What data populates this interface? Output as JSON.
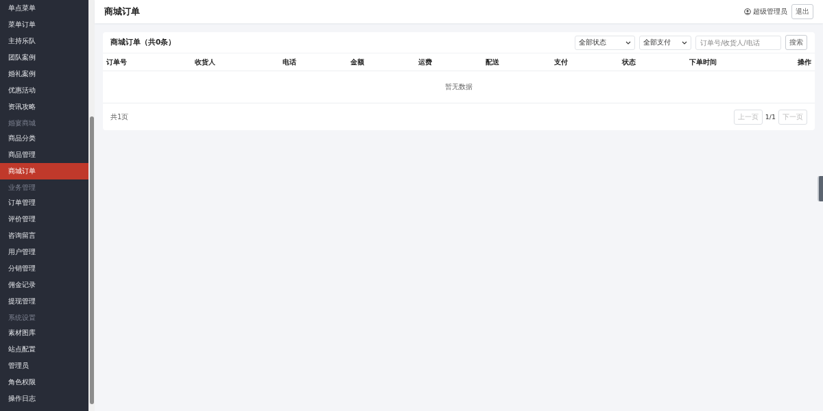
{
  "sidebar": {
    "sections": [
      {
        "items": [
          {
            "label": "单点菜单",
            "selected": false
          },
          {
            "label": "菜单订单",
            "selected": false
          },
          {
            "label": "主持乐队",
            "selected": false
          },
          {
            "label": "团队案例",
            "selected": false
          },
          {
            "label": "婚礼案例",
            "selected": false
          },
          {
            "label": "优惠活动",
            "selected": false
          },
          {
            "label": "资讯攻略",
            "selected": false
          }
        ]
      },
      {
        "label": "婚宴商城",
        "items": [
          {
            "label": "商品分类",
            "selected": false
          },
          {
            "label": "商品管理",
            "selected": false
          },
          {
            "label": "商城订单",
            "selected": true
          }
        ]
      },
      {
        "label": "业务管理",
        "items": [
          {
            "label": "订单管理",
            "selected": false
          },
          {
            "label": "评价管理",
            "selected": false
          },
          {
            "label": "咨询留言",
            "selected": false
          },
          {
            "label": "用户管理",
            "selected": false
          },
          {
            "label": "分销管理",
            "selected": false
          },
          {
            "label": "佣金记录",
            "selected": false
          },
          {
            "label": "提现管理",
            "selected": false
          }
        ]
      },
      {
        "label": "系统设置",
        "items": [
          {
            "label": "素材图库",
            "selected": false
          },
          {
            "label": "站点配置",
            "selected": false
          },
          {
            "label": "管理员",
            "selected": false
          },
          {
            "label": "角色权限",
            "selected": false
          },
          {
            "label": "操作日志",
            "selected": false
          }
        ]
      }
    ]
  },
  "header": {
    "title": "商城订单",
    "user": "超级管理员",
    "logout": "退出"
  },
  "panel": {
    "title": "商城订单（共0条）",
    "filters": [
      {
        "value": "全部状态"
      },
      {
        "value": "全部支付"
      }
    ],
    "search": {
      "placeholder": "订单号/收货人/电话",
      "button": "搜索"
    },
    "table": {
      "columns": [
        "订单号",
        "收货人",
        "电话",
        "金额",
        "运费",
        "配送",
        "支付",
        "状态",
        "下单时间",
        "操作"
      ],
      "empty": "暂无数据"
    },
    "pager": {
      "total": "共1页",
      "prev": {
        "label": "上一页",
        "disabled": true
      },
      "page": "1/1",
      "next": {
        "label": "下一页",
        "disabled": true
      }
    }
  }
}
